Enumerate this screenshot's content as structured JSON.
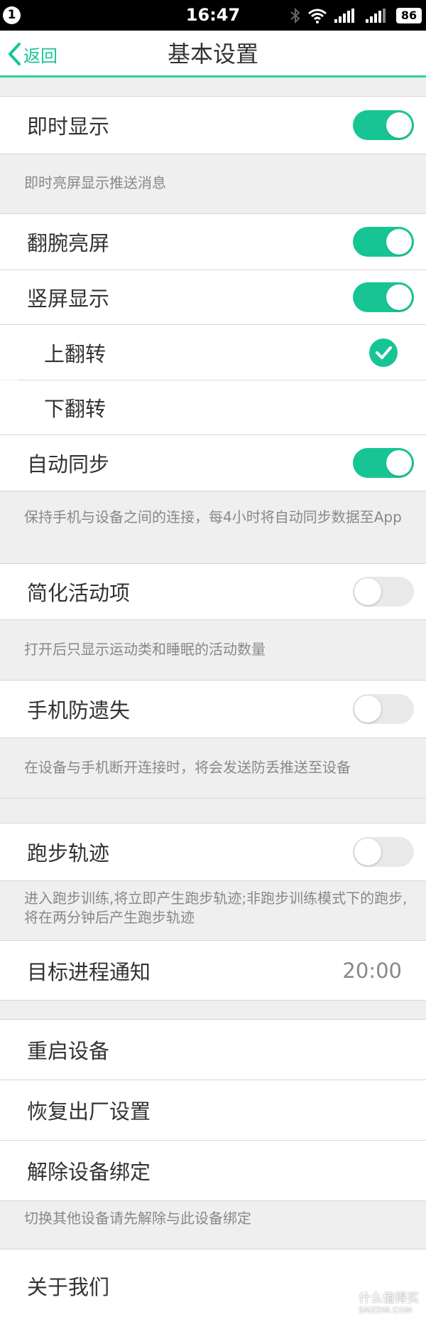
{
  "status_bar": {
    "notification_count": "1",
    "time": "16:47",
    "battery": "86"
  },
  "nav": {
    "back_label": "返回",
    "title": "基本设置"
  },
  "settings": {
    "instant_display": {
      "label": "即时显示",
      "on": true,
      "desc": "即时亮屏显示推送消息"
    },
    "wrist_wake": {
      "label": "翻腕亮屏",
      "on": true
    },
    "portrait_display": {
      "label": "竖屏显示",
      "on": true
    },
    "flip_up": {
      "label": "上翻转",
      "checked": true
    },
    "flip_down": {
      "label": "下翻转",
      "checked": false
    },
    "auto_sync": {
      "label": "自动同步",
      "on": true,
      "desc": "保持手机与设备之间的连接，每4小时将自动同步数据至App"
    },
    "simplify_activity": {
      "label": "简化活动项",
      "on": false,
      "desc": "打开后只显示运动类和睡眠的活动数量"
    },
    "anti_lost": {
      "label": "手机防遗失",
      "on": false,
      "desc": "在设备与手机断开连接时，将会发送防丢推送至设备"
    },
    "running_track": {
      "label": "跑步轨迹",
      "on": false,
      "desc": "进入跑步训练,将立即产生跑步轨迹;非跑步训练模式下的跑步,将在两分钟后产生跑步轨迹"
    },
    "goal_notification": {
      "label": "目标进程通知",
      "value": "20:00"
    },
    "restart_device": {
      "label": "重启设备"
    },
    "factory_reset": {
      "label": "恢复出厂设置"
    },
    "unbind_device": {
      "label": "解除设备绑定",
      "desc": "切换其他设备请先解除与此设备绑定"
    },
    "about_us": {
      "label": "关于我们"
    }
  },
  "watermark": {
    "main": "什么值得买",
    "sub": "SMZDM.COM"
  },
  "colors": {
    "accent": "#17c594",
    "nav_underline": "#2bd3a2",
    "background": "#efefef"
  }
}
